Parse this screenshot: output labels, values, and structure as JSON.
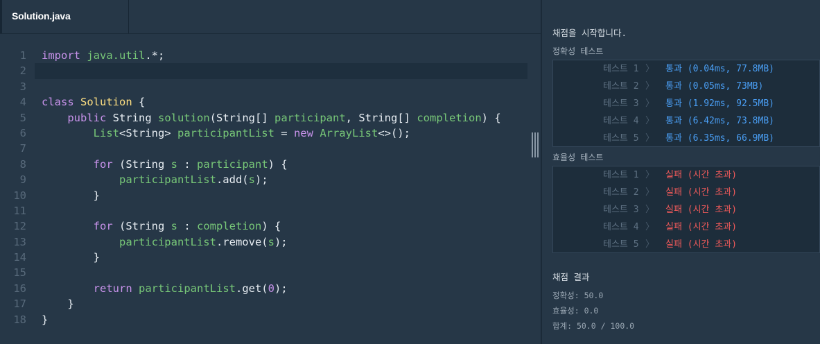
{
  "editor": {
    "tab_label": "Solution.java",
    "lines": [
      {
        "n": "1"
      },
      {
        "n": "2"
      },
      {
        "n": "3"
      },
      {
        "n": "4"
      },
      {
        "n": "5"
      },
      {
        "n": "6"
      },
      {
        "n": "7"
      },
      {
        "n": "8"
      },
      {
        "n": "9"
      },
      {
        "n": "10"
      },
      {
        "n": "11"
      },
      {
        "n": "12"
      },
      {
        "n": "13"
      },
      {
        "n": "14"
      },
      {
        "n": "15"
      },
      {
        "n": "16"
      },
      {
        "n": "17"
      },
      {
        "n": "18"
      }
    ],
    "tokens": {
      "l1_kw": "import",
      "l1_pkg": "java.util",
      "l1_rest": ".*;",
      "l4_kw": "class",
      "l4_name": "Solution",
      "l4_rest": " {",
      "l5_kw": "public",
      "l5_type": "String",
      "l5_method": "solution",
      "l5_p1t": "String[]",
      "l5_p1": "participant",
      "l5_p2t": "String[]",
      "l5_p2": "completion",
      "l5_end": ") {",
      "l6_type": "List",
      "l6_gen": "<String>",
      "l6_var": "participantList",
      "l6_eq": " = ",
      "l6_new": "new",
      "l6_cls": "ArrayList",
      "l6_end": "<>();",
      "l8_kw": "for",
      "l8_open": " (String ",
      "l8_s": "s",
      "l8_colon": " : ",
      "l8_it": "participant",
      "l8_end": ") {",
      "l9_var": "participantList",
      "l9_m": ".add(",
      "l9_s": "s",
      "l9_end": ");",
      "l10": "}",
      "l12_kw": "for",
      "l12_open": " (String ",
      "l12_s": "s",
      "l12_colon": " : ",
      "l12_it": "completion",
      "l12_end": ") {",
      "l13_var": "participantList",
      "l13_m": ".remove(",
      "l13_s": "s",
      "l13_end": ");",
      "l14": "}",
      "l16_kw": "return",
      "l16_var": "participantList",
      "l16_m": ".get(",
      "l16_num": "0",
      "l16_end": ");",
      "l17": "}",
      "l18": "}"
    }
  },
  "results": {
    "start_message": "채점을 시작합니다.",
    "accuracy_section": "정확성  테스트",
    "efficiency_section": "효율성  테스트",
    "accuracy_tests": [
      {
        "name": "테스트 1",
        "result": "통과 (0.04ms, 77.8MB)"
      },
      {
        "name": "테스트 2",
        "result": "통과 (0.05ms, 73MB)"
      },
      {
        "name": "테스트 3",
        "result": "통과 (1.92ms, 92.5MB)"
      },
      {
        "name": "테스트 4",
        "result": "통과 (6.42ms, 73.8MB)"
      },
      {
        "name": "테스트 5",
        "result": "통과 (6.35ms, 66.9MB)"
      }
    ],
    "efficiency_tests": [
      {
        "name": "테스트 1",
        "result": "실패 (시간 초과)"
      },
      {
        "name": "테스트 2",
        "result": "실패 (시간 초과)"
      },
      {
        "name": "테스트 3",
        "result": "실패 (시간 초과)"
      },
      {
        "name": "테스트 4",
        "result": "실패 (시간 초과)"
      },
      {
        "name": "테스트 5",
        "result": "실패 (시간 초과)"
      }
    ],
    "arrow": "〉",
    "summary_title": "채점 결과",
    "accuracy_score": "정확성: 50.0",
    "efficiency_score": "효율성: 0.0",
    "total_score": "합계: 50.0 / 100.0"
  },
  "colors": {
    "pass": "#4a9ff5",
    "fail": "#f05a5a",
    "keyword": "#c792ea",
    "type": "#ffe082",
    "identifier": "#78c878"
  }
}
